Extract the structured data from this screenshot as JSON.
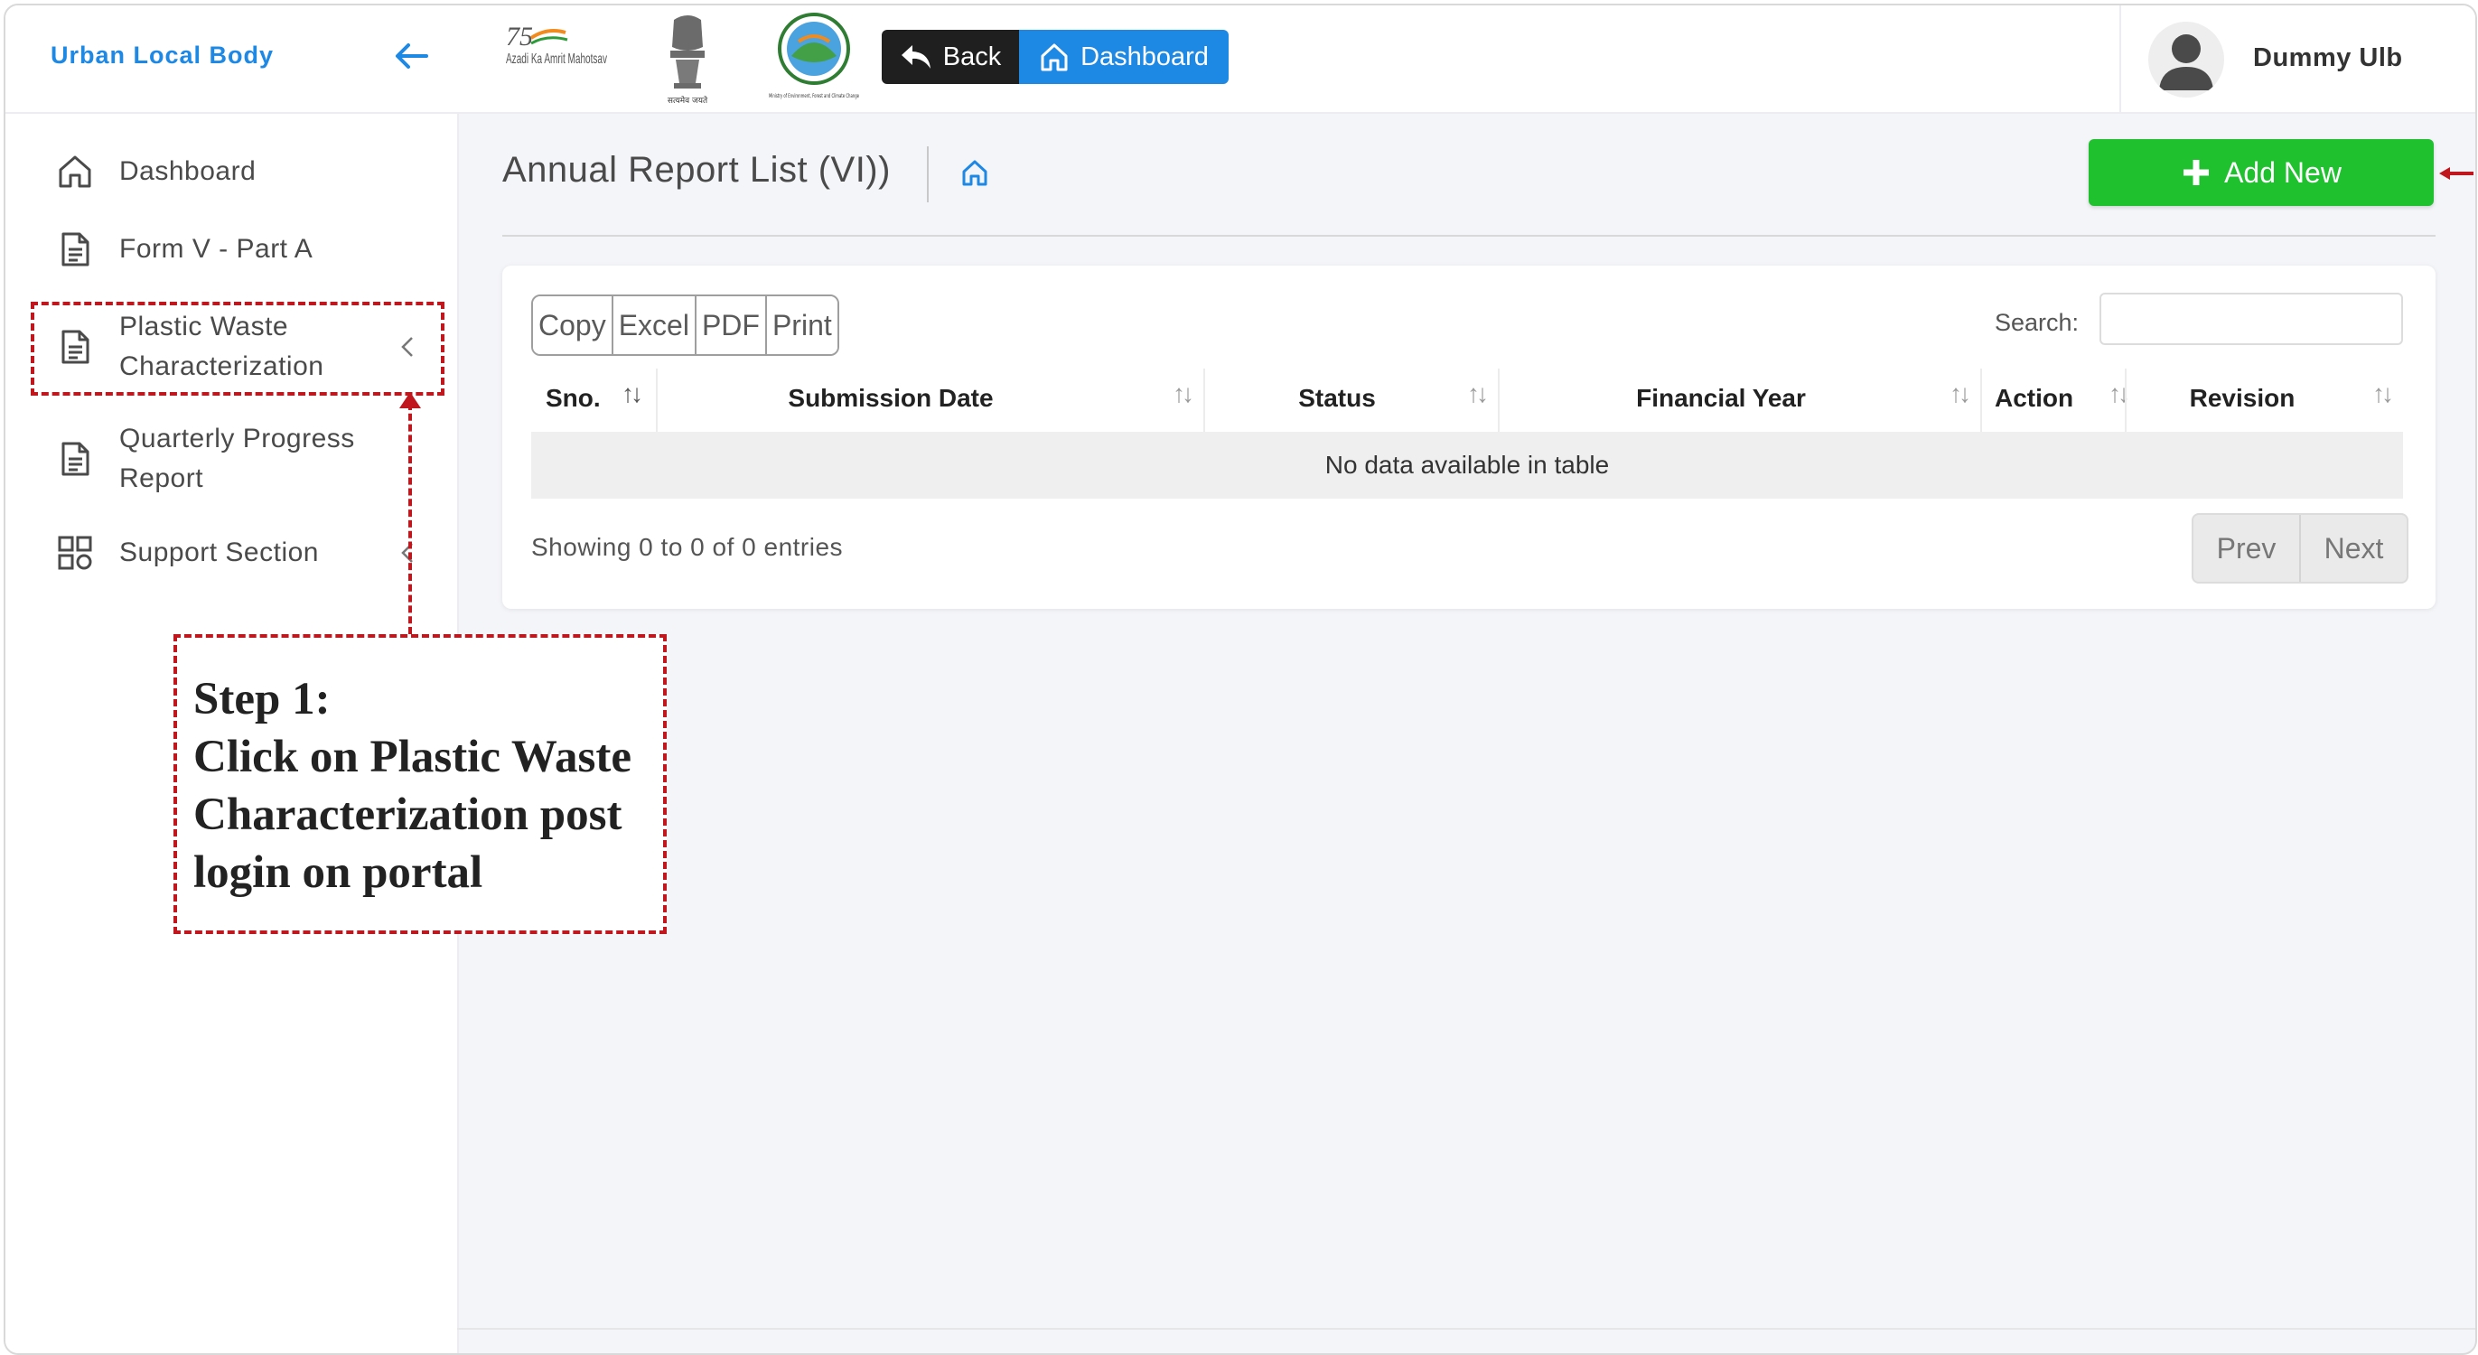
{
  "sidebar": {
    "brand_title": "Urban Local Body",
    "items": [
      {
        "label": "Dashboard",
        "icon": "home-icon"
      },
      {
        "label": "Form V - Part A",
        "icon": "document-icon"
      },
      {
        "label": "Plastic Waste Characterization",
        "icon": "document-icon"
      },
      {
        "label": "Quarterly Progress Report",
        "icon": "document-icon"
      },
      {
        "label": "Support Section",
        "icon": "grid-icon"
      }
    ]
  },
  "header": {
    "logos": [
      {
        "name": "azadi-ka-amrit-mahotsav-logo",
        "text": "Azadi Ka Amrit Mahotsav"
      },
      {
        "name": "national-emblem-logo",
        "text": "सत्यमेव जयते"
      },
      {
        "name": "ministry-environment-logo",
        "text": "Ministry of Environment, Forest and Climate Change"
      }
    ],
    "back_label": "Back",
    "dashboard_label": "Dashboard",
    "user_name": "Dummy Ulb"
  },
  "main": {
    "page_title": "Annual Report List (VI))",
    "add_new_label": "Add New",
    "export_buttons": [
      "Copy",
      "Excel",
      "PDF",
      "Print"
    ],
    "search_label": "Search:",
    "search_value": "",
    "columns": [
      "Sno.",
      "Submission Date",
      "Status",
      "Financial Year",
      "Action",
      "Revision"
    ],
    "empty_message": "No data available in table",
    "info_text": "Showing 0 to 0 of 0 entries",
    "pager": {
      "prev": "Prev",
      "next": "Next"
    }
  },
  "annotation": {
    "text_lines": [
      "Step 1:",
      "Click on Plastic Waste",
      "Characterization post",
      "login on portal"
    ]
  },
  "colors": {
    "accent": "#1e88e5",
    "add_button": "#1fc12f",
    "annotation": "#c0161e",
    "back_button": "#1f1f1f"
  }
}
